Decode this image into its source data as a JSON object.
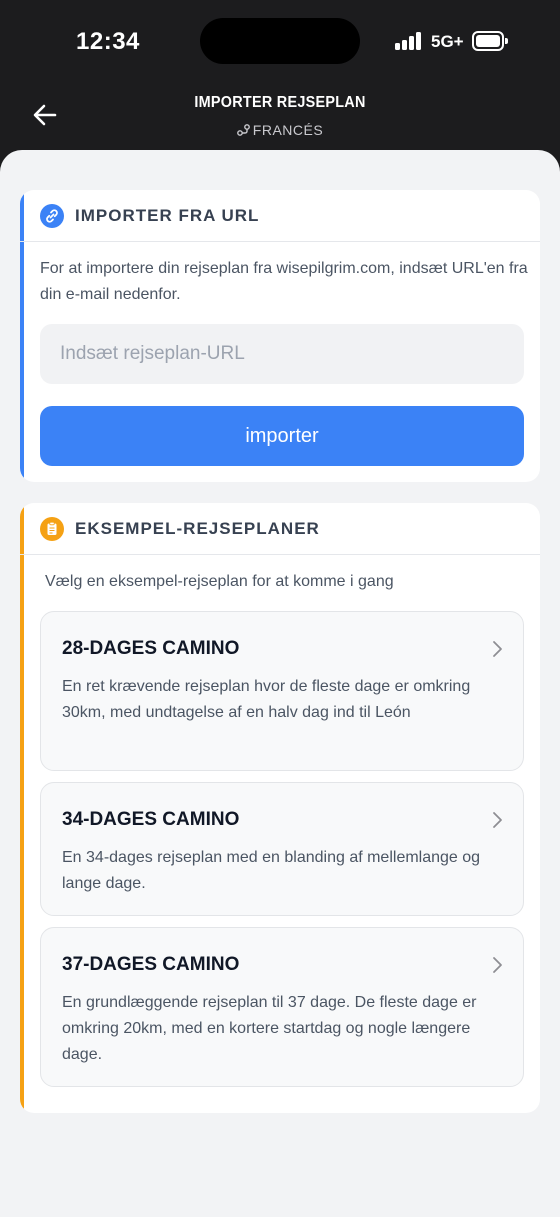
{
  "status_bar": {
    "time": "12:34",
    "network": "5G+"
  },
  "header": {
    "title": "IMPORTER REJSEPLAN",
    "subtitle": "FRANCÉS"
  },
  "import_card": {
    "title": "IMPORTER FRA URL",
    "description": "For at importere din rejseplan fra wisepilgrim.com, indsæt URL'en fra din e-mail nedenfor.",
    "input_placeholder": "Indsæt rejseplan-URL",
    "input_value": "",
    "button_label": "importer",
    "accent_color": "#3b82f6"
  },
  "examples_card": {
    "title": "EKSEMPEL-REJSEPLANER",
    "description": "Vælg en eksempel-rejseplan for at komme i gang",
    "accent_color": "#f5a114",
    "plans": [
      {
        "title": "28-DAGES CAMINO",
        "description": "En ret krævende rejseplan hvor de fleste dage er omkring 30km, med undtagelse af en halv dag ind til León"
      },
      {
        "title": "34-DAGES CAMINO",
        "description": "En 34-dages rejseplan med en blanding af mellemlange og lange dage."
      },
      {
        "title": "37-DAGES CAMINO",
        "description": "En grundlæggende rejseplan til 37 dage. De fleste dage er omkring 20km, med en kortere startdag og nogle længere dage."
      }
    ]
  },
  "icons": {
    "back": "arrow-left-icon",
    "route": "route-icon",
    "link": "link-icon",
    "clipboard": "clipboard-icon",
    "chevron": "chevron-right-icon"
  }
}
